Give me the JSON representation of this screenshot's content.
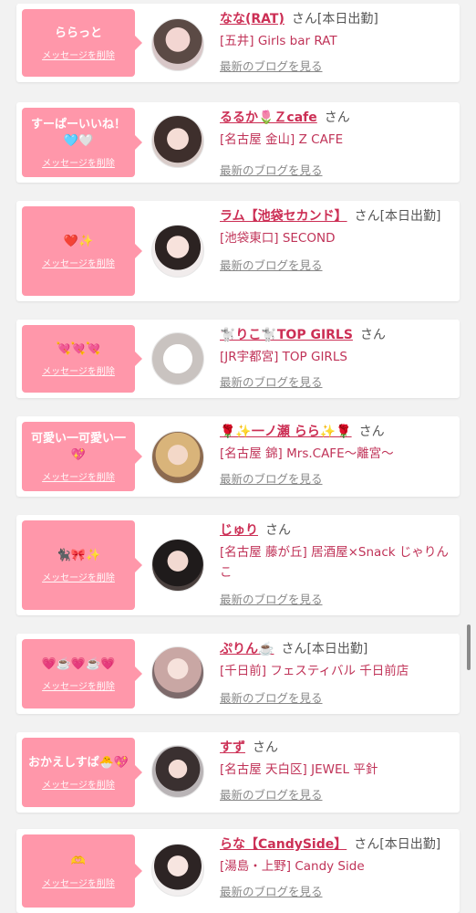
{
  "delete_label": "メッセージを削除",
  "blog_label": "最新のブログを見る",
  "san_label": "さん",
  "items": [
    {
      "message": "ららっと",
      "name": "なな(RAT)",
      "status": "[本日出勤]",
      "shop": "[五井] Girls bar RAT"
    },
    {
      "message": "すーぱーいいね！🩵🤍",
      "name": "るるか🌷Ｚcafe",
      "status": "",
      "shop": "[名古屋 金山] Z CAFE"
    },
    {
      "message": "❤️✨",
      "name": "ラム【池袋セカンド】",
      "status": "[本日出勤]",
      "shop": "[池袋東口] SECOND"
    },
    {
      "message": "💘💘💘",
      "name": "🐩りこ🐩TOP GIRLS",
      "status": "",
      "shop": "[JR宇都宮] TOP GIRLS"
    },
    {
      "message": "可愛い一可愛い一💖",
      "name": "🌹✨一ノ瀬 らら✨🌹",
      "status": "",
      "shop": "[名古屋 錦] Mrs.CAFE〜離宮〜"
    },
    {
      "message": "🐈‍⬛🎀✨",
      "name": "じゅり",
      "status": "",
      "shop": "[名古屋 藤が丘] 居酒屋×Snack じゃりんこ"
    },
    {
      "message": "💗☕️💗☕️💗",
      "name": "ぷりん☕️",
      "status": "[本日出勤]",
      "shop": "[千日前] フェスティバル 千日前店"
    },
    {
      "message": "おかえしすぱ🐣💖",
      "name": "すず",
      "status": "",
      "shop": "[名古屋 天白区] JEWEL 平針"
    },
    {
      "message": "🫶",
      "name": "らな【CandySide】",
      "status": "[本日出勤]",
      "shop": "[湯島・上野] Candy Side"
    }
  ]
}
